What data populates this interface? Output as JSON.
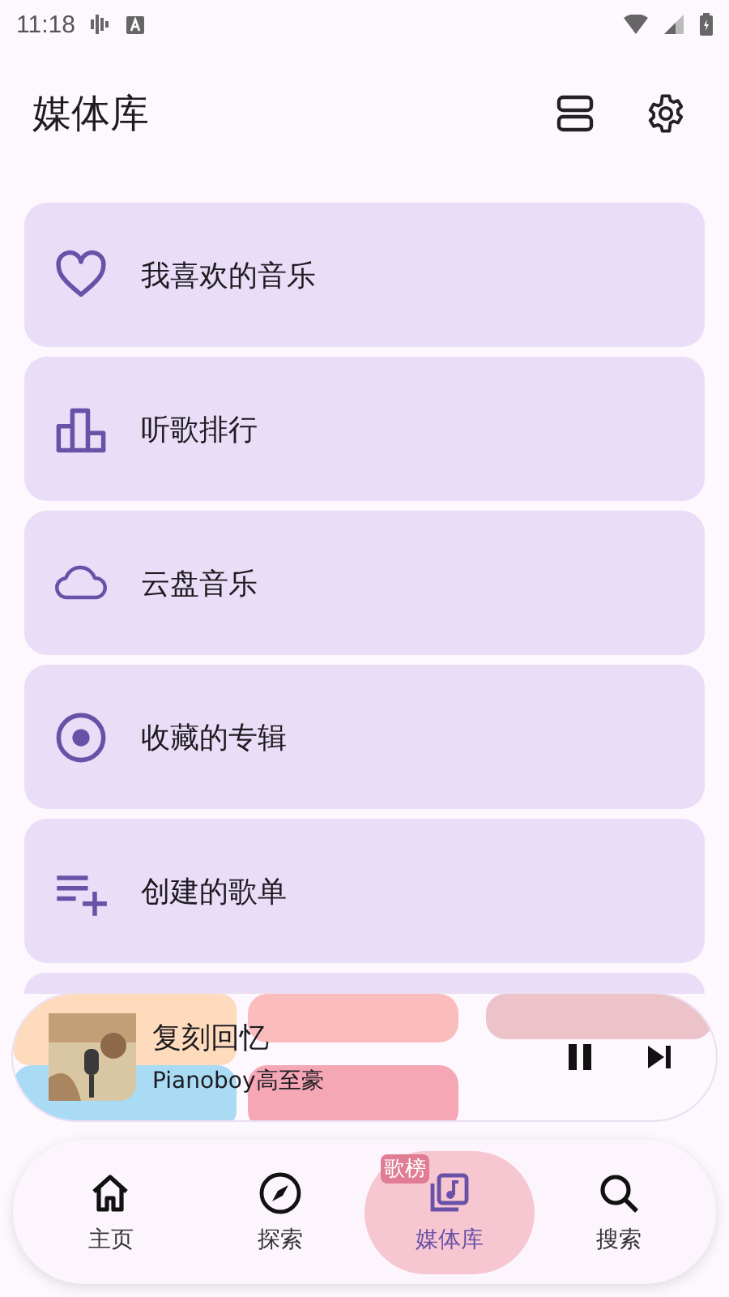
{
  "status_bar": {
    "time": "11:18"
  },
  "app_bar": {
    "title": "媒体库"
  },
  "items": [
    {
      "label": "我喜欢的音乐"
    },
    {
      "label": "听歌排行"
    },
    {
      "label": "云盘音乐"
    },
    {
      "label": "收藏的专辑"
    },
    {
      "label": "创建的歌单"
    }
  ],
  "mini_player": {
    "title": "复刻回忆",
    "artist": "Pianoboy高至豪",
    "playing": true
  },
  "nav": [
    {
      "label": "主页",
      "selected": false
    },
    {
      "label": "探索",
      "selected": false
    },
    {
      "label": "媒体库",
      "selected": true,
      "overlay_text": "歌榜"
    },
    {
      "label": "搜索",
      "selected": false
    }
  ]
}
